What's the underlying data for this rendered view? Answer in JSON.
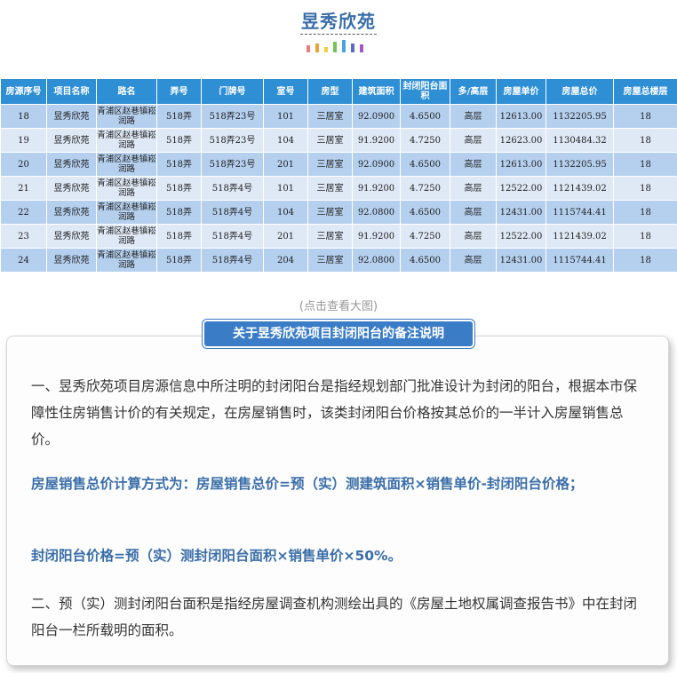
{
  "header": {
    "title": "昱秀欣苑",
    "accent_colors": [
      "#e77f7f",
      "#e9a23b",
      "#f3cf3c",
      "#77c05a",
      "#4aa3df",
      "#5b6bc6",
      "#9d59c7"
    ]
  },
  "table": {
    "columns": [
      "房源序号",
      "项目名称",
      "路名",
      "弄号",
      "门牌号",
      "室号",
      "房型",
      "建筑面积",
      "封闭阳台面积",
      "多/高层",
      "房屋单价",
      "房屋总价",
      "房屋总楼层"
    ],
    "rows": [
      [
        "18",
        "昱秀欣苑",
        "青浦区赵巷镇崧润路",
        "518弄",
        "518弄23号",
        "101",
        "三居室",
        "92.0900",
        "4.6500",
        "高层",
        "12613.00",
        "1132205.95",
        "18"
      ],
      [
        "19",
        "昱秀欣苑",
        "青浦区赵巷镇崧润路",
        "518弄",
        "518弄23号",
        "104",
        "三居室",
        "91.9200",
        "4.7250",
        "高层",
        "12623.00",
        "1130484.32",
        "18"
      ],
      [
        "20",
        "昱秀欣苑",
        "青浦区赵巷镇崧润路",
        "518弄",
        "518弄23号",
        "201",
        "三居室",
        "92.0900",
        "4.6500",
        "高层",
        "12613.00",
        "1132205.95",
        "18"
      ],
      [
        "21",
        "昱秀欣苑",
        "青浦区赵巷镇崧润路",
        "518弄",
        "518弄4号",
        "101",
        "三居室",
        "91.9200",
        "4.7250",
        "高层",
        "12522.00",
        "1121439.02",
        "18"
      ],
      [
        "22",
        "昱秀欣苑",
        "青浦区赵巷镇崧润路",
        "518弄",
        "518弄4号",
        "104",
        "三居室",
        "92.0800",
        "4.6500",
        "高层",
        "12431.00",
        "1115744.41",
        "18"
      ],
      [
        "23",
        "昱秀欣苑",
        "青浦区赵巷镇崧润路",
        "518弄",
        "518弄4号",
        "201",
        "三居室",
        "91.9200",
        "4.7250",
        "高层",
        "12522.00",
        "1121439.02",
        "18"
      ],
      [
        "24",
        "昱秀欣苑",
        "青浦区赵巷镇崧润路",
        "518弄",
        "518弄4号",
        "204",
        "三居室",
        "92.0800",
        "4.6500",
        "高层",
        "12431.00",
        "1115744.41",
        "18"
      ]
    ]
  },
  "caption": "(点击查看大图)",
  "note": {
    "title": "关于昱秀欣苑项目封闭阳台的备注说明",
    "p1": "一、昱秀欣苑项目房源信息中所注明的封闭阳台是指经规划部门批准设计为封闭的阳台，根据本市保障性住房销售计价的有关规定，在房屋销售时，该类封闭阳台价格按其总价的一半计入房屋销售总价。",
    "p2": "房屋销售总价计算方式为：房屋销售总价=预（实）测建筑面积×销售单价-封闭阳台价格；",
    "p3": "封闭阳台价格=预（实）测封闭阳台面积×销售单价×50%。",
    "p4": "二、预（实）测封闭阳台面积是指经房屋调查机构测绘出具的《房屋土地权属调查报告书》中在封闭阳台一栏所载明的面积。"
  }
}
